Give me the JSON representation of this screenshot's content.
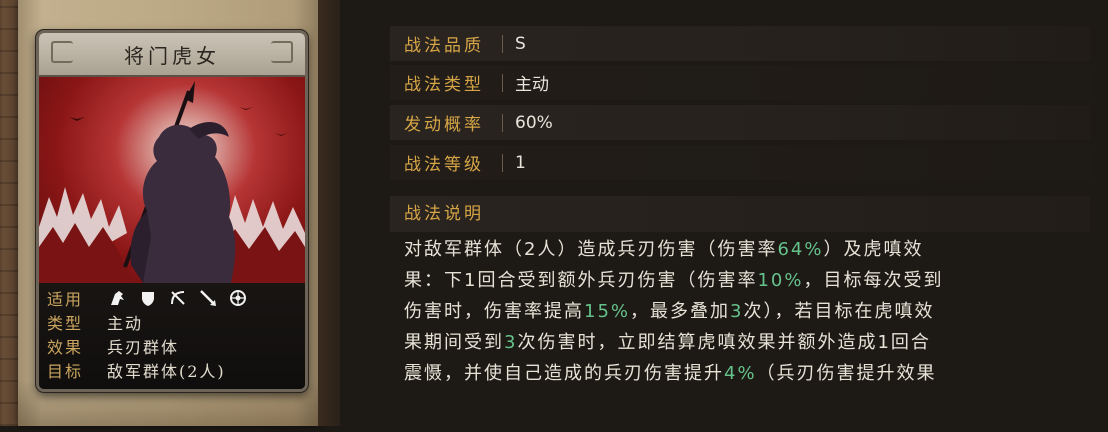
{
  "card": {
    "name": "将门虎女",
    "attributes": {
      "usable_label": "适用",
      "type_label": "类型",
      "type_value": "主动",
      "effect_label": "效果",
      "effect_value": "兵刃群体",
      "target_label": "目标",
      "target_value": "敌军群体(2人)"
    },
    "unit_icons": [
      "cavalry-icon",
      "shield-icon",
      "bow-icon",
      "spear-icon",
      "siege-icon"
    ]
  },
  "properties": [
    {
      "key": "战法品质",
      "value": "S"
    },
    {
      "key": "战法类型",
      "value": "主动"
    },
    {
      "key": "发动概率",
      "value": "60%"
    },
    {
      "key": "战法等级",
      "value": "1"
    }
  ],
  "description": {
    "heading": "战法说明",
    "lines": [
      [
        {
          "t": "对敌军群体（2人）造成兵刃伤害（伤害率"
        },
        {
          "t": "64%",
          "g": true
        },
        {
          "t": "）及虎嗔效"
        }
      ],
      [
        {
          "t": "果：下1回合受到额外兵刃伤害（伤害率"
        },
        {
          "t": "10%",
          "g": true
        },
        {
          "t": "，目标每次受到"
        }
      ],
      [
        {
          "t": "伤害时，伤害率提高"
        },
        {
          "t": "15%",
          "g": true
        },
        {
          "t": "，最多叠加"
        },
        {
          "t": "3",
          "g": true
        },
        {
          "t": "次），若目标在虎嗔效"
        }
      ],
      [
        {
          "t": "果期间受到"
        },
        {
          "t": "3",
          "g": true
        },
        {
          "t": "次伤害时，立即结算虎嗔效果并额外造成1回合"
        }
      ],
      [
        {
          "t": "震慑，并使自己造成的兵刃伤害提升"
        },
        {
          "t": "4%",
          "g": true
        },
        {
          "t": "（兵刃伤害提升效果"
        }
      ]
    ]
  },
  "colors": {
    "label_gold": "#d6a646",
    "value_text": "#e8e4da",
    "highlight_green": "#66c28b",
    "art_red": "#b63535"
  }
}
